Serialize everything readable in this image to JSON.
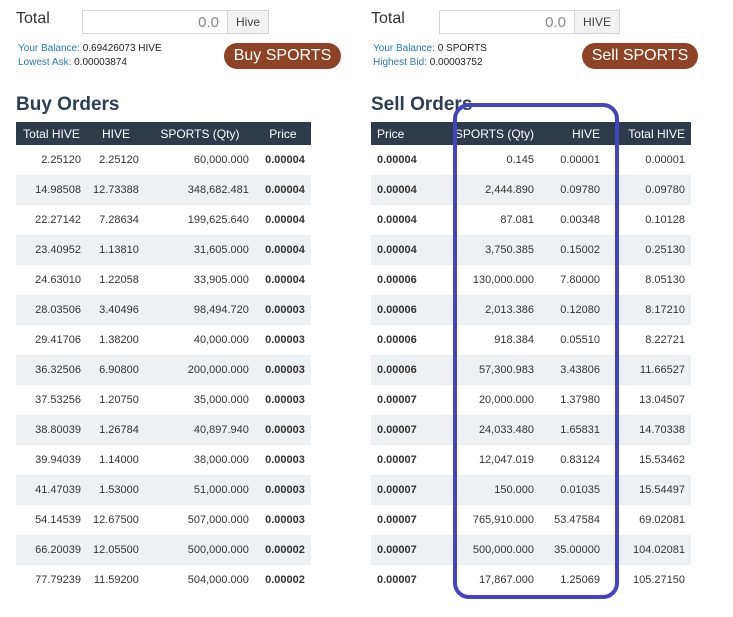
{
  "buy": {
    "total_label": "Total",
    "total_value": "0.0",
    "total_unit": "Hive",
    "balance_label": "Your Balance:",
    "balance_value": "0.69426073 HIVE",
    "ask_label": "Lowest Ask:",
    "ask_value": "0.00003874",
    "button_label": "Buy SPORTS",
    "title": "Buy Orders",
    "columns": [
      "Total HIVE",
      "HIVE",
      "SPORTS (Qty)",
      "Price"
    ],
    "rows": [
      [
        "2.25120",
        "2.25120",
        "60,000.000",
        "0.00004"
      ],
      [
        "14.98508",
        "12.73388",
        "348,682.481",
        "0.00004"
      ],
      [
        "22.27142",
        "7.28634",
        "199,625.640",
        "0.00004"
      ],
      [
        "23.40952",
        "1.13810",
        "31,605.000",
        "0.00004"
      ],
      [
        "24.63010",
        "1.22058",
        "33,905.000",
        "0.00004"
      ],
      [
        "28.03506",
        "3.40496",
        "98,494.720",
        "0.00003"
      ],
      [
        "29.41706",
        "1.38200",
        "40,000.000",
        "0.00003"
      ],
      [
        "36.32506",
        "6.90800",
        "200,000.000",
        "0.00003"
      ],
      [
        "37.53256",
        "1.20750",
        "35,000.000",
        "0.00003"
      ],
      [
        "38.80039",
        "1.26784",
        "40,897.940",
        "0.00003"
      ],
      [
        "39.94039",
        "1.14000",
        "38,000.000",
        "0.00003"
      ],
      [
        "41.47039",
        "1.53000",
        "51,000.000",
        "0.00003"
      ],
      [
        "54.14539",
        "12.67500",
        "507,000.000",
        "0.00003"
      ],
      [
        "66.20039",
        "12.05500",
        "500,000.000",
        "0.00002"
      ],
      [
        "77.79239",
        "11.59200",
        "504,000.000",
        "0.00002"
      ]
    ]
  },
  "sell": {
    "total_label": "Total",
    "total_value": "0.0",
    "total_unit": "HIVE",
    "balance_label": "Your Balance:",
    "balance_value": "0 SPORTS",
    "bid_label": "Highest Bid:",
    "bid_value": "0.00003752",
    "button_label": "Sell SPORTS",
    "title": "Sell Orders",
    "columns": [
      "Price",
      "SPORTS (Qty)",
      "HIVE",
      "Total HIVE"
    ],
    "rows": [
      [
        "0.00004",
        "0.145",
        "0.00001",
        "0.00001"
      ],
      [
        "0.00004",
        "2,444.890",
        "0.09780",
        "0.09780"
      ],
      [
        "0.00004",
        "87.081",
        "0.00348",
        "0.10128"
      ],
      [
        "0.00004",
        "3,750.385",
        "0.15002",
        "0.25130"
      ],
      [
        "0.00006",
        "130,000.000",
        "7.80000",
        "8.05130"
      ],
      [
        "0.00006",
        "2,013.386",
        "0.12080",
        "8.17210"
      ],
      [
        "0.00006",
        "918.384",
        "0.05510",
        "8.22721"
      ],
      [
        "0.00006",
        "57,300.983",
        "3.43806",
        "11.66527"
      ],
      [
        "0.00007",
        "20,000.000",
        "1.37980",
        "13.04507"
      ],
      [
        "0.00007",
        "24,033.480",
        "1.65831",
        "14.70338"
      ],
      [
        "0.00007",
        "12,047.019",
        "0.83124",
        "15.53462"
      ],
      [
        "0.00007",
        "150.000",
        "0.01035",
        "15.54497"
      ],
      [
        "0.00007",
        "765,910.000",
        "53.47584",
        "69.02081"
      ],
      [
        "0.00007",
        "500,000.000",
        "35.00000",
        "104.02081"
      ],
      [
        "0.00007",
        "17,867.000",
        "1.25069",
        "105.27150"
      ]
    ]
  },
  "colors": {
    "button": "#8f4326",
    "header": "#2f3b4a",
    "link": "#2a7aa8",
    "highlight": "#4343c4"
  }
}
